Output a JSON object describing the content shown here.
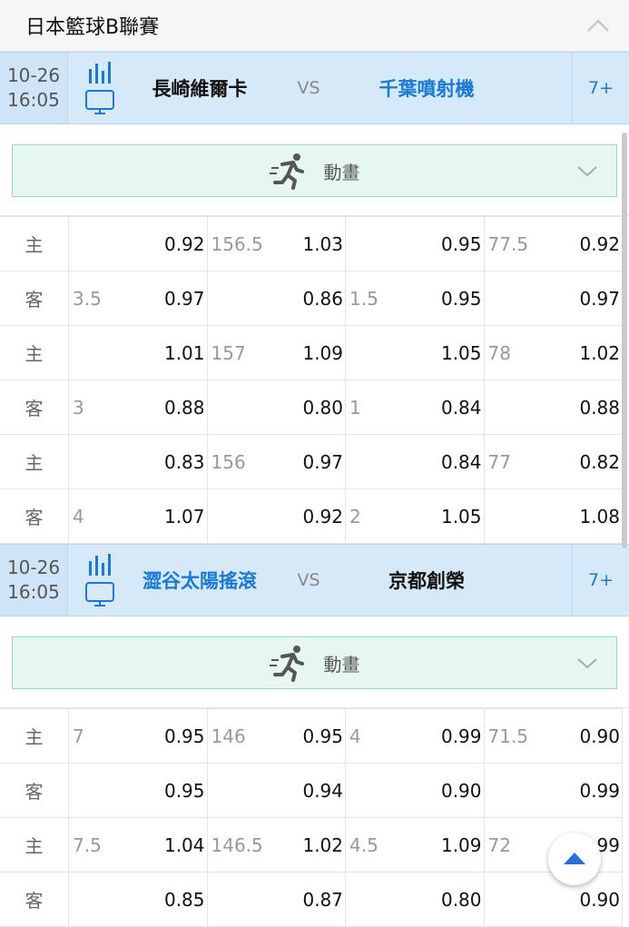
{
  "league": {
    "title": "日本籃球B聯賽"
  },
  "matches": [
    {
      "date": "10-26",
      "time": "16:05",
      "home": "長崎維爾卡",
      "vs": "VS",
      "away": "千葉噴射機",
      "more": "7+",
      "animation_label": "動畫",
      "rows": [
        {
          "side": "主",
          "c1h": "",
          "c1o": "0.92",
          "c2h": "156.5",
          "c2o": "1.03",
          "c3h": "",
          "c3o": "0.95",
          "c4h": "77.5",
          "c4o": "0.92"
        },
        {
          "side": "客",
          "c1h": "3.5",
          "c1o": "0.97",
          "c2h": "",
          "c2o": "0.86",
          "c3h": "1.5",
          "c3o": "0.95",
          "c4h": "",
          "c4o": "0.97"
        },
        {
          "side": "主",
          "c1h": "",
          "c1o": "1.01",
          "c2h": "157",
          "c2o": "1.09",
          "c3h": "",
          "c3o": "1.05",
          "c4h": "78",
          "c4o": "1.02"
        },
        {
          "side": "客",
          "c1h": "3",
          "c1o": "0.88",
          "c2h": "",
          "c2o": "0.80",
          "c3h": "1",
          "c3o": "0.84",
          "c4h": "",
          "c4o": "0.88"
        },
        {
          "side": "主",
          "c1h": "",
          "c1o": "0.83",
          "c2h": "156",
          "c2o": "0.97",
          "c3h": "",
          "c3o": "0.84",
          "c4h": "77",
          "c4o": "0.82"
        },
        {
          "side": "客",
          "c1h": "4",
          "c1o": "1.07",
          "c2h": "",
          "c2o": "0.92",
          "c3h": "2",
          "c3o": "1.05",
          "c4h": "",
          "c4o": "1.08"
        }
      ]
    },
    {
      "date": "10-26",
      "time": "16:05",
      "home": "澀谷太陽搖滾",
      "vs": "VS",
      "away": "京都創榮",
      "more": "7+",
      "animation_label": "動畫",
      "rows": [
        {
          "side": "主",
          "c1h": "7",
          "c1o": "0.95",
          "c2h": "146",
          "c2o": "0.95",
          "c3h": "4",
          "c3o": "0.99",
          "c4h": "71.5",
          "c4o": "0.90"
        },
        {
          "side": "客",
          "c1h": "",
          "c1o": "0.95",
          "c2h": "",
          "c2o": "0.94",
          "c3h": "",
          "c3o": "0.90",
          "c4h": "",
          "c4o": "0.99"
        },
        {
          "side": "主",
          "c1h": "7.5",
          "c1o": "1.04",
          "c2h": "146.5",
          "c2o": "1.02",
          "c3h": "4.5",
          "c3o": "1.09",
          "c4h": "72",
          "c4o": "0.99"
        },
        {
          "side": "客",
          "c1h": "",
          "c1o": "0.85",
          "c2h": "",
          "c2o": "0.87",
          "c3h": "",
          "c3o": "0.80",
          "c4h": "",
          "c4o": "0.90"
        }
      ]
    }
  ]
}
